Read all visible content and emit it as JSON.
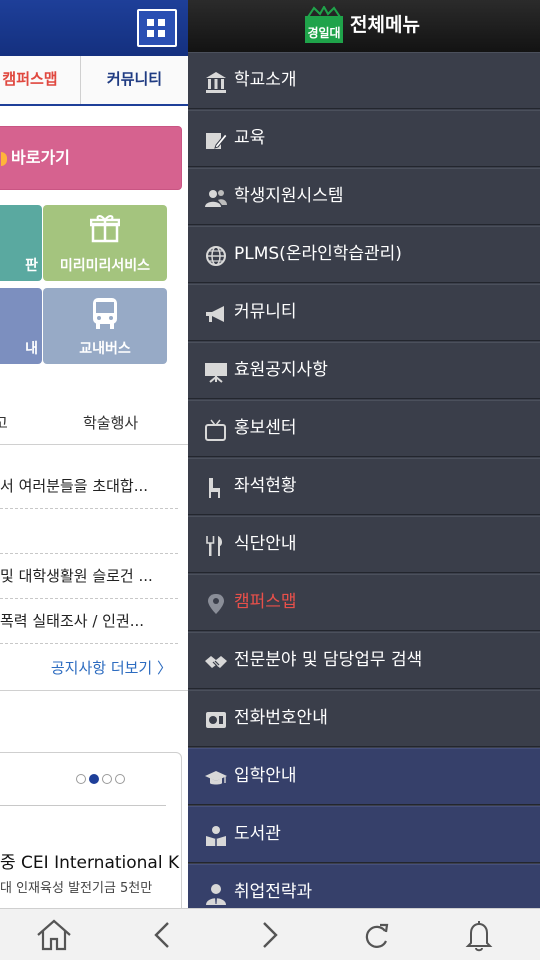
{
  "page": {
    "tabs": [
      {
        "label": "캠퍼스맵"
      },
      {
        "label": "커뮤니티"
      }
    ],
    "shortcut_label": "바로가기",
    "tiles": [
      {
        "label": "판"
      },
      {
        "label": "미리미리서비스"
      },
      {
        "label": "내"
      },
      {
        "label": "교내버스"
      }
    ],
    "notice_tabs": [
      {
        "label": "고"
      },
      {
        "label": "학술행사"
      }
    ],
    "news": [
      {
        "text": "서 여러분들을 초대합..."
      },
      {
        "text": ""
      },
      {
        "text": "및 대학생활원 슬로건 ..."
      },
      {
        "text": "폭력 실태조사 / 인권..."
      }
    ],
    "more_label": "공지사항 더보기 〉",
    "card": {
      "title": "중 CEI International K",
      "subtitle": "대 인재육성 발전기금 5천만"
    },
    "carousel": {
      "count": 4,
      "active": 1
    }
  },
  "menu": {
    "title": "전체메뉴",
    "logo_text": "경일대",
    "items": [
      {
        "label": "학교소개",
        "icon": "building-icon"
      },
      {
        "label": "교육",
        "icon": "pencil-book-icon"
      },
      {
        "label": "학생지원시스템",
        "icon": "people-icon"
      },
      {
        "label": "PLMS(온라인학습관리)",
        "icon": "globe-icon"
      },
      {
        "label": "커뮤니티",
        "icon": "megaphone-icon"
      },
      {
        "label": "효원공지사항",
        "icon": "board-icon"
      },
      {
        "label": "홍보센터",
        "icon": "tv-icon"
      },
      {
        "label": "좌석현황",
        "icon": "chair-icon"
      },
      {
        "label": "식단안내",
        "icon": "fork-knife-icon"
      },
      {
        "label": "캠퍼스맵",
        "icon": "map-pin-icon",
        "highlight": "#e8504a"
      },
      {
        "label": "전문분야 및 담당업무 검색",
        "icon": "handshake-icon"
      },
      {
        "label": "전화번호안내",
        "icon": "phone-book-icon"
      },
      {
        "label": "입학안내",
        "icon": "graduation-cap-icon"
      },
      {
        "label": "도서관",
        "icon": "reader-icon"
      },
      {
        "label": "취업전략과",
        "icon": "person-suit-icon"
      }
    ]
  },
  "bottom_bar": [
    "home-icon",
    "back-icon",
    "forward-icon",
    "refresh-icon",
    "bell-icon"
  ],
  "colors": {
    "primary_blue": "#1e3f99",
    "drawer_bg": "#3a3e4a",
    "drawer_alt_bg": "#36406a",
    "accent_red": "#e8504a",
    "pink": "#d6628f",
    "green": "#a4c47e",
    "teal": "#5aa9a0"
  }
}
